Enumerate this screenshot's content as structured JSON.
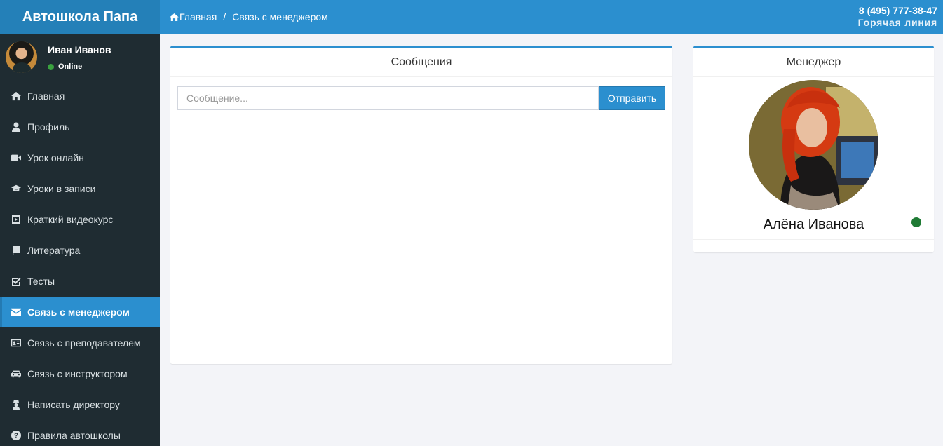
{
  "brand": "Автошкола Папа",
  "breadcrumb": {
    "home": "Главная",
    "separator": "/",
    "current": "Связь с менеджером"
  },
  "hotline": {
    "phone": "8 (495) 777-38-47",
    "label": "Горячая линия"
  },
  "user": {
    "name": "Иван Иванов",
    "status": "Online"
  },
  "menu": [
    {
      "label": "Главная",
      "icon": "home-icon"
    },
    {
      "label": "Профиль",
      "icon": "user-icon"
    },
    {
      "label": "Урок онлайн",
      "icon": "video-camera-icon"
    },
    {
      "label": "Уроки в записи",
      "icon": "graduation-cap-icon"
    },
    {
      "label": "Краткий видеокурс",
      "icon": "play-square-icon"
    },
    {
      "label": "Литература",
      "icon": "book-icon"
    },
    {
      "label": "Тесты",
      "icon": "check-square-icon"
    },
    {
      "label": "Связь с менеджером",
      "icon": "envelope-icon",
      "active": true
    },
    {
      "label": "Связь с преподавателем",
      "icon": "id-card-icon"
    },
    {
      "label": "Связь с инструктором",
      "icon": "car-icon"
    },
    {
      "label": "Написать директору",
      "icon": "user-secret-icon"
    },
    {
      "label": "Правила автошколы",
      "icon": "question-circle-icon"
    }
  ],
  "messages": {
    "title": "Сообщения",
    "placeholder": "Сообщение...",
    "send_label": "Отправить"
  },
  "manager": {
    "title": "Менеджер",
    "name": "Алёна Иванова",
    "status_color": "#1f7a34"
  },
  "colors": {
    "accent": "#2b8fcf",
    "sidebar": "#1f2c32"
  }
}
